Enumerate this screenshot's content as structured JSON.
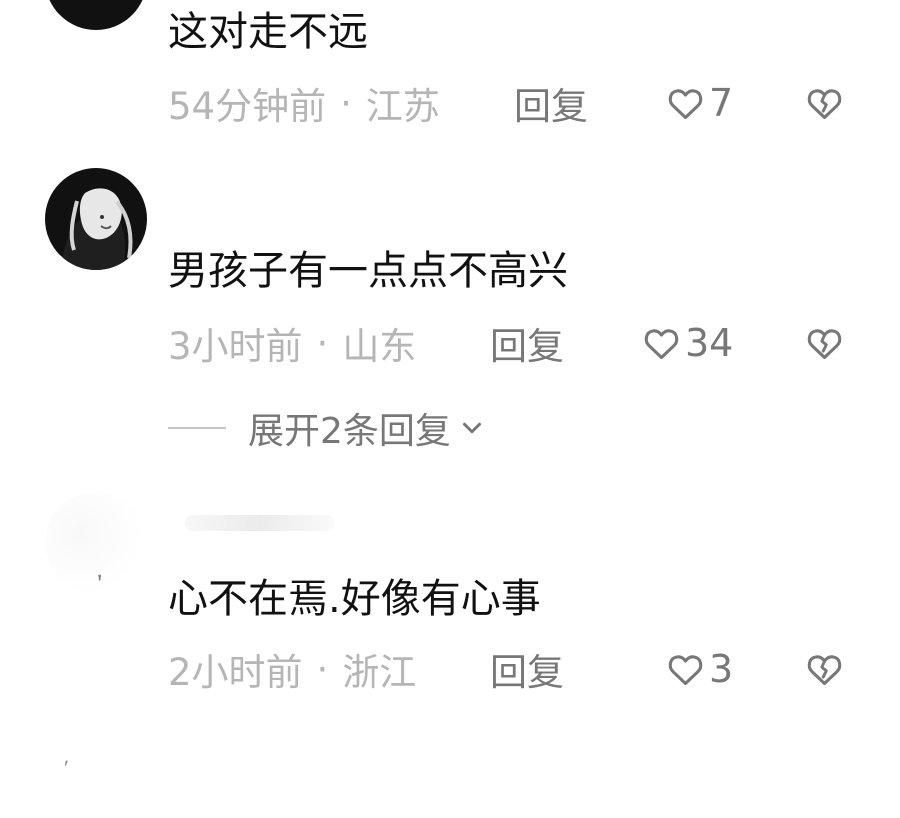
{
  "comments": [
    {
      "username": "",
      "text": "这对走不远",
      "time": "54分钟前",
      "location": "江苏",
      "reply": "回复",
      "likes": "7"
    },
    {
      "username": "",
      "text": "男孩子有一点点不高兴",
      "time": "3小时前",
      "location": "山东",
      "reply": "回复",
      "likes": "34",
      "expand": "展开2条回复"
    },
    {
      "username": "",
      "text": "心不在焉.好像有心事",
      "time": "2小时前",
      "location": "浙江",
      "reply": "回复",
      "likes": "3"
    }
  ],
  "separator": "·",
  "partial_text": "",
  "icons": {
    "like": "heart-outline-icon",
    "dislike": "broken-heart-outline-icon",
    "expand": "chevron-down-icon"
  },
  "colors": {
    "text": "#111111",
    "meta": "#b5b5b5",
    "action": "#777777"
  }
}
